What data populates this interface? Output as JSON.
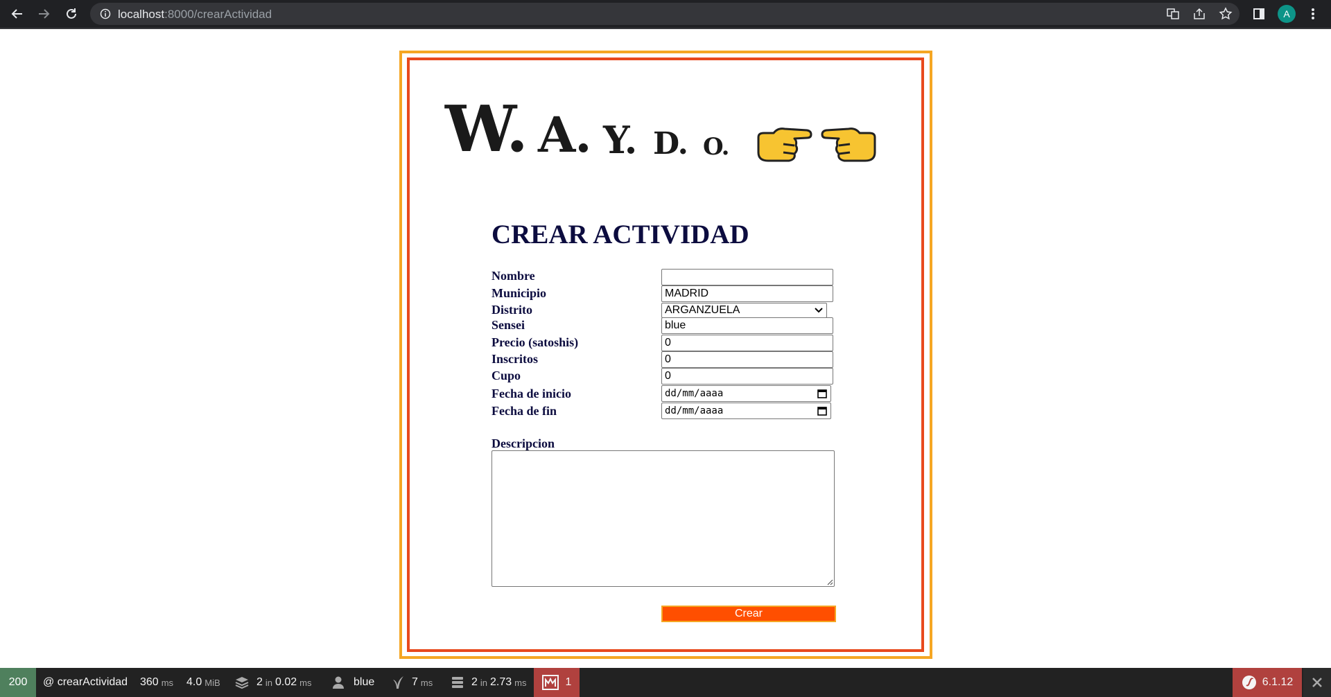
{
  "browser": {
    "url_host": "localhost",
    "url_path": ":8000/crearActividad",
    "profile_initial": "A"
  },
  "logo": {
    "letters": [
      "W.",
      "A.",
      "Y.",
      "D.",
      "O."
    ]
  },
  "form": {
    "title": "CREAR ACTIVIDAD",
    "fields": {
      "nombre": {
        "label": "Nombre",
        "value": ""
      },
      "municipio": {
        "label": "Municipio",
        "value": "MADRID"
      },
      "distrito": {
        "label": "Distrito",
        "value": "ARGANZUELA"
      },
      "sensei": {
        "label": "Sensei",
        "value": "blue"
      },
      "precio": {
        "label": "Precio (satoshis)",
        "value": "0"
      },
      "inscritos": {
        "label": "Inscritos",
        "value": "0"
      },
      "cupo": {
        "label": "Cupo",
        "value": "0"
      },
      "fecha_inicio": {
        "label": "Fecha de inicio",
        "value": "dd/mm/aaaa"
      },
      "fecha_fin": {
        "label": "Fecha de fin",
        "value": "dd/mm/aaaa"
      },
      "descripcion": {
        "label": "Descripcion",
        "value": ""
      }
    },
    "submit_label": "Crear"
  },
  "toolbar": {
    "status_code": "200",
    "route": "@ crearActividad",
    "time_value": "360",
    "time_unit": "ms",
    "memory_value": "4.0",
    "memory_unit": "MiB",
    "cache_count": "2",
    "cache_in": "in",
    "cache_time": "0.02",
    "cache_unit": "ms",
    "user": "blue",
    "twig_time": "7",
    "twig_unit": "ms",
    "db_count": "2",
    "db_in": "in",
    "db_time": "2.73",
    "db_unit": "ms",
    "error_count": "1",
    "symfony_version": "6.1.12"
  },
  "colors": {
    "outer_border": "#f5a623",
    "inner_border": "#e8491d",
    "title_text": "#0c0c3f",
    "submit_bg": "#ff4f00",
    "hand_fill": "#f7c431",
    "status_ok": "#4f805d",
    "toolbar_error": "#b0413e"
  }
}
